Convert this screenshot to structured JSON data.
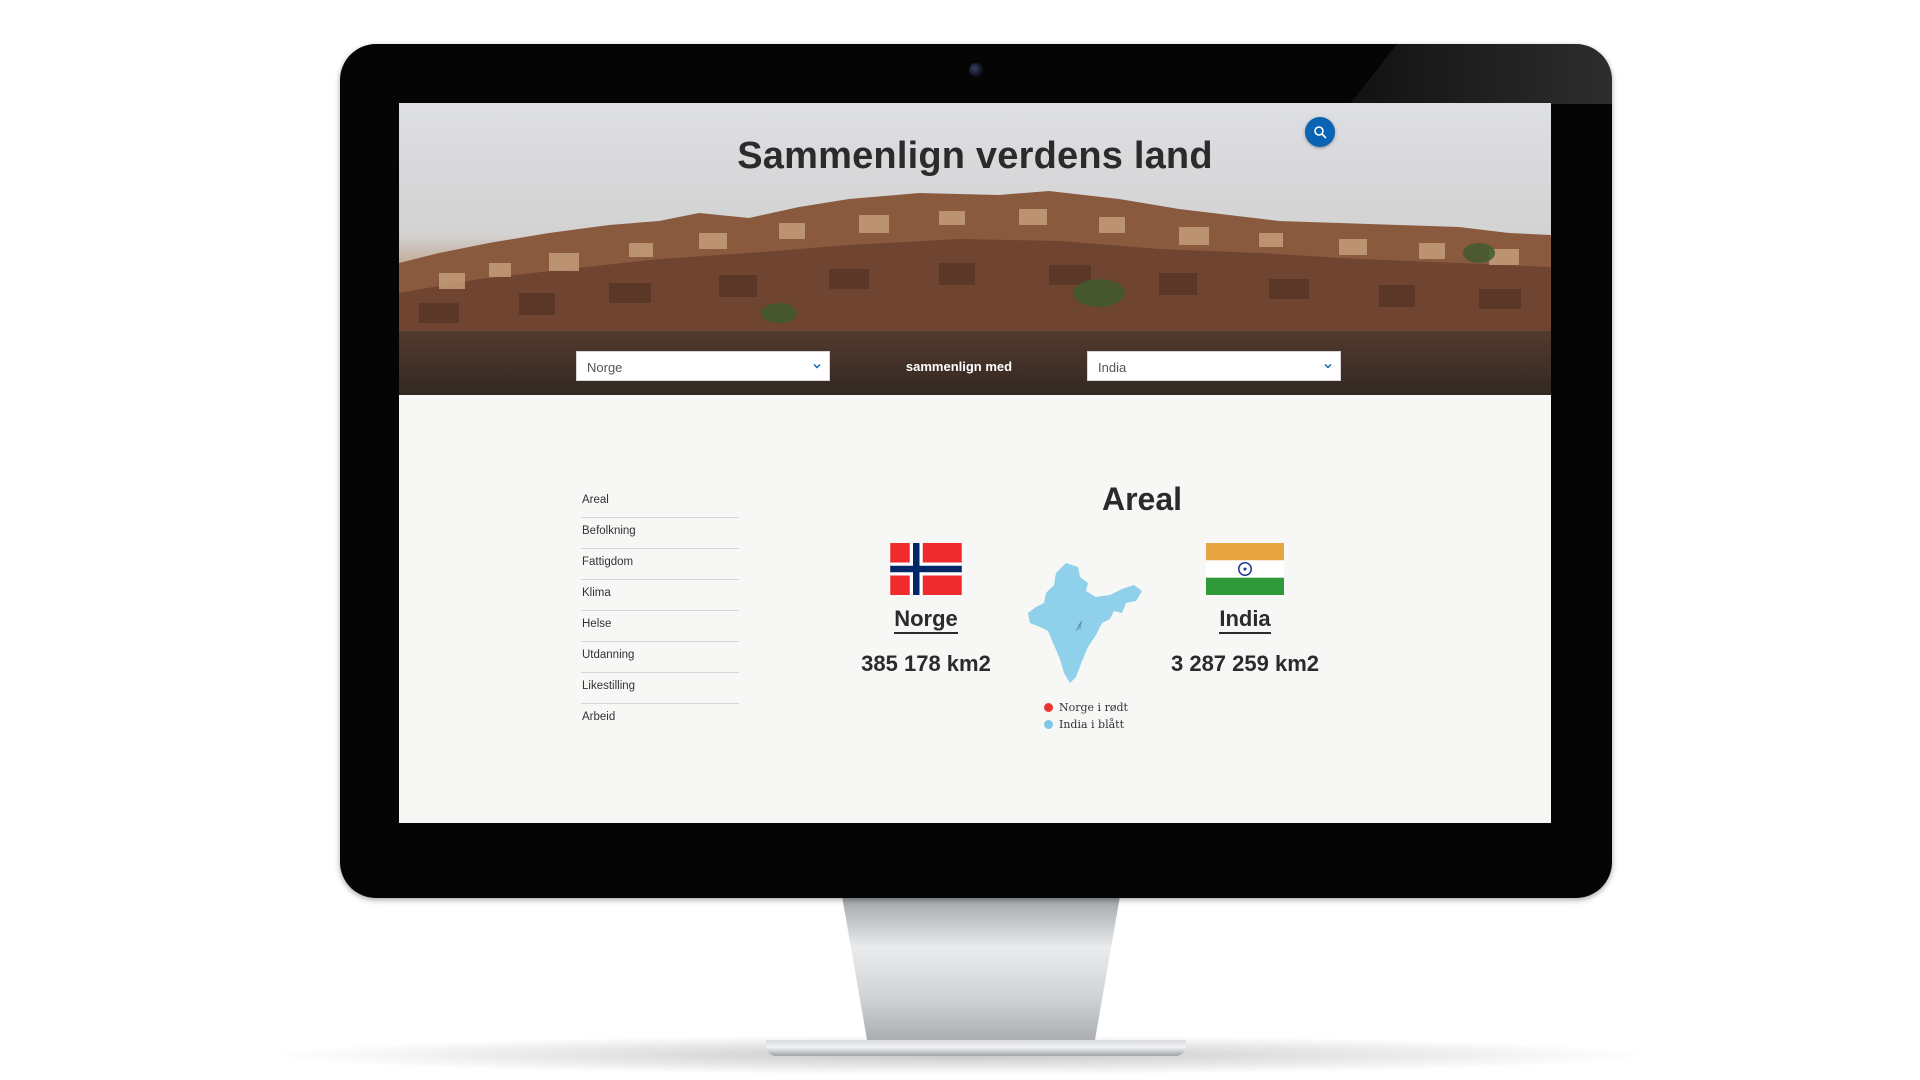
{
  "header": {
    "title": "Sammenlign verdens land"
  },
  "compare": {
    "country_a": "Norge",
    "connector": "sammenlign med",
    "country_b": "India"
  },
  "sidebar": {
    "items": [
      {
        "label": "Areal"
      },
      {
        "label": "Befolkning"
      },
      {
        "label": "Fattigdom"
      },
      {
        "label": "Klima"
      },
      {
        "label": "Helse"
      },
      {
        "label": "Utdanning"
      },
      {
        "label": "Likestilling"
      },
      {
        "label": "Arbeid"
      }
    ]
  },
  "section": {
    "title": "Areal",
    "countries": [
      {
        "name": "Norge",
        "area": "385 178 km2",
        "flag": "norway-flag"
      },
      {
        "name": "India",
        "area": "3 287 259 km2",
        "flag": "india-flag"
      }
    ],
    "legend": [
      {
        "label": "Norge i rødt",
        "color": "#e8382e"
      },
      {
        "label": "India i blått",
        "color": "#7ec8e6"
      }
    ]
  },
  "icons": {
    "search": "search-icon",
    "dropdown": "chevron-down-icon"
  },
  "colors": {
    "accent": "#0a64b4",
    "norway_red": "#ef2b2d",
    "norway_blue": "#002868",
    "india_saffron": "#e8a440",
    "india_green": "#2e9a3a",
    "map_blue": "#8fd0ea"
  }
}
